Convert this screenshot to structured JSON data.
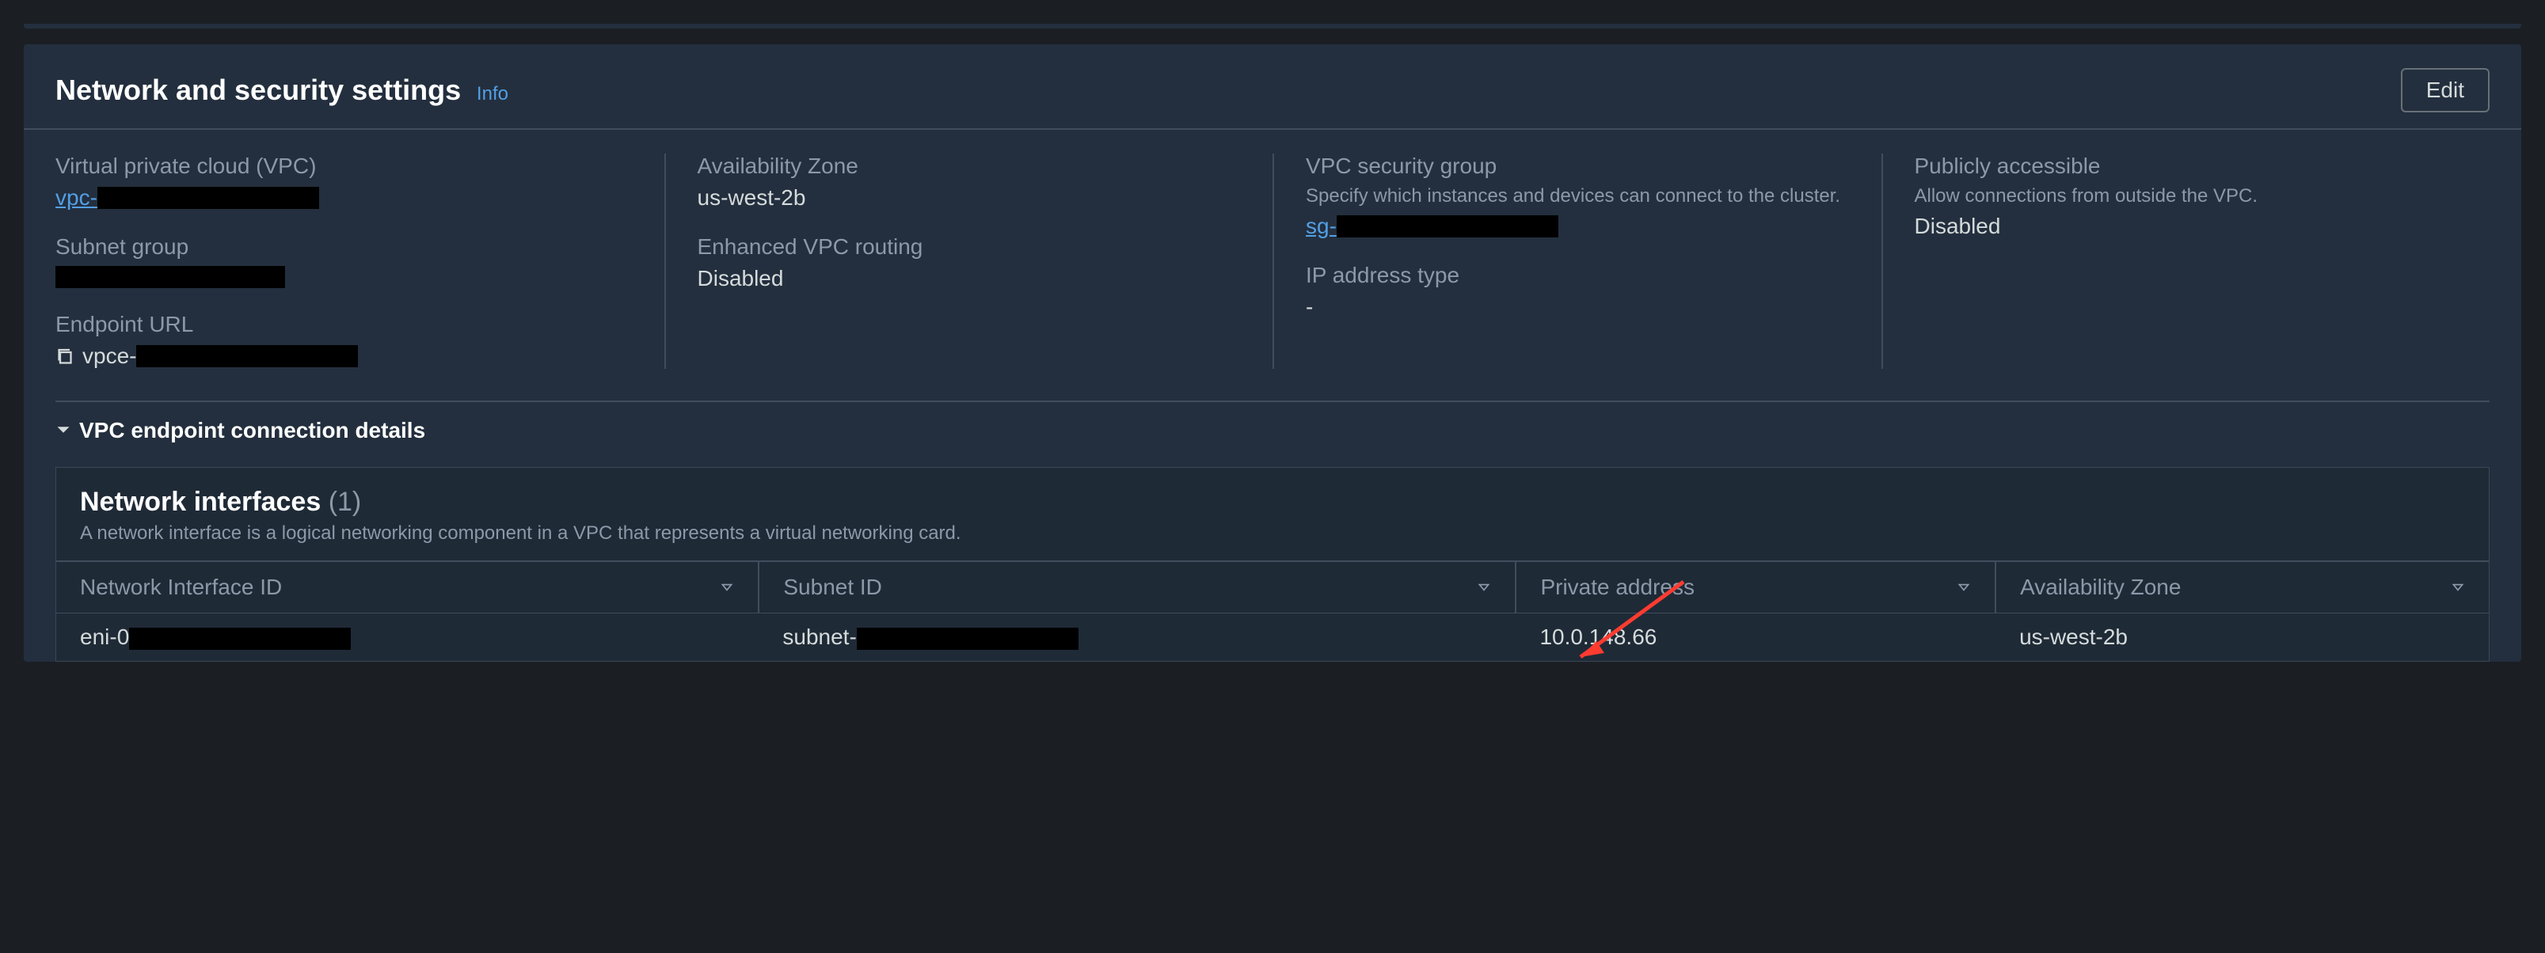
{
  "header": {
    "title": "Network and security settings",
    "info": "Info",
    "edit": "Edit"
  },
  "fields": {
    "vpc": {
      "label": "Virtual private cloud (VPC)",
      "prefix": "vpc-"
    },
    "subnet_group": {
      "label": "Subnet group"
    },
    "endpoint_url": {
      "label": "Endpoint URL",
      "prefix": "vpce-"
    },
    "az": {
      "label": "Availability Zone",
      "value": "us-west-2b"
    },
    "evr": {
      "label": "Enhanced VPC routing",
      "value": "Disabled"
    },
    "sg": {
      "label": "VPC security group",
      "sub": "Specify which instances and devices can connect to the cluster.",
      "prefix": "sg-"
    },
    "ip_type": {
      "label": "IP address type",
      "value": "-"
    },
    "public": {
      "label": "Publicly accessible",
      "sub": "Allow connections from outside the VPC.",
      "value": "Disabled"
    }
  },
  "collapser": {
    "title": "VPC endpoint connection details"
  },
  "sub": {
    "title": "Network interfaces",
    "count": "(1)",
    "desc": "A network interface is a logical networking component in a VPC that represents a virtual networking card."
  },
  "table": {
    "cols": [
      "Network Interface ID",
      "Subnet ID",
      "Private address",
      "Availability Zone"
    ],
    "row": {
      "eni_prefix": "eni-0",
      "subnet_prefix": "subnet-",
      "private_addr": "10.0.148.66",
      "az": "us-west-2b"
    }
  }
}
